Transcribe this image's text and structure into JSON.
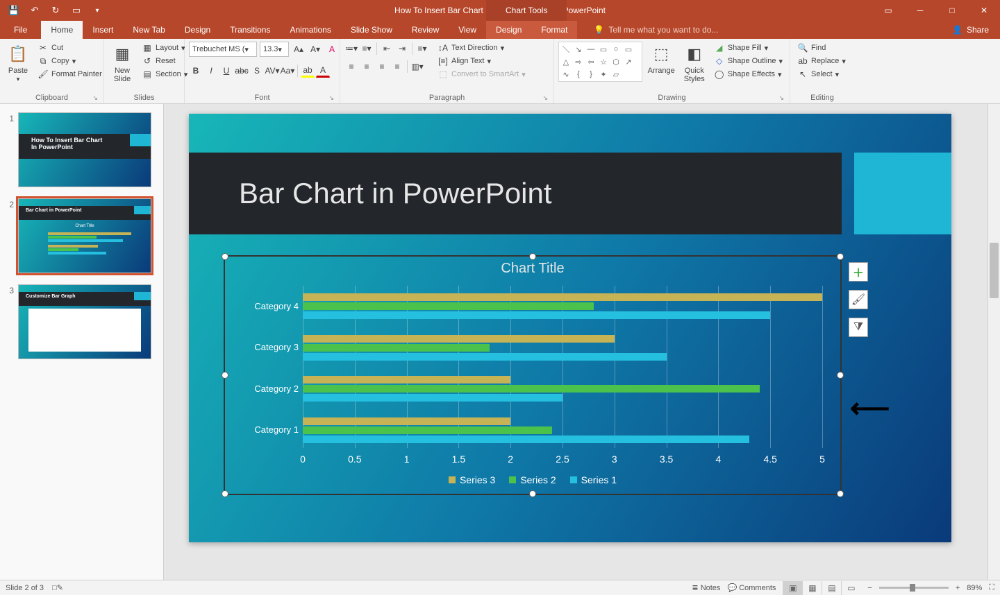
{
  "titlebar": {
    "doc_title": "How To Insert Bar Chart In PowerPoint.pptx - PowerPoint",
    "chart_tools": "Chart Tools"
  },
  "tabs": {
    "file": "File",
    "home": "Home",
    "insert": "Insert",
    "newtab": "New Tab",
    "design": "Design",
    "transitions": "Transitions",
    "animations": "Animations",
    "slideshow": "Slide Show",
    "review": "Review",
    "view": "View",
    "ctx_design": "Design",
    "ctx_format": "Format",
    "tellme": "Tell me what you want to do...",
    "share": "Share"
  },
  "ribbon": {
    "clipboard": {
      "label": "Clipboard",
      "paste": "Paste",
      "cut": "Cut",
      "copy": "Copy",
      "format_painter": "Format Painter"
    },
    "slides": {
      "label": "Slides",
      "new_slide": "New\nSlide",
      "layout": "Layout",
      "reset": "Reset",
      "section": "Section"
    },
    "font": {
      "label": "Font",
      "family": "Trebuchet MS (",
      "size": "13.3"
    },
    "paragraph": {
      "label": "Paragraph",
      "text_direction": "Text Direction",
      "align_text": "Align Text",
      "smartart": "Convert to SmartArt"
    },
    "drawing": {
      "label": "Drawing",
      "arrange": "Arrange",
      "quick_styles": "Quick\nStyles",
      "shape_fill": "Shape Fill",
      "shape_outline": "Shape Outline",
      "shape_effects": "Shape Effects"
    },
    "editing": {
      "label": "Editing",
      "find": "Find",
      "replace": "Replace",
      "select": "Select"
    }
  },
  "thumbs": {
    "t1": "How To Insert Bar Chart\nIn PowerPoint",
    "t2": "Bar Chart in PowerPoint",
    "t3": "Customize Bar Graph"
  },
  "slide": {
    "title": "Bar Chart in PowerPoint"
  },
  "chart_data": {
    "type": "bar",
    "title": "Chart Title",
    "orientation": "horizontal",
    "categories": [
      "Category 4",
      "Category 3",
      "Category 2",
      "Category 1"
    ],
    "series": [
      {
        "name": "Series 3",
        "color": "#c5b356",
        "values": [
          5.0,
          3.0,
          2.0,
          2.0
        ]
      },
      {
        "name": "Series 2",
        "color": "#4bc24b",
        "values": [
          2.8,
          1.8,
          4.4,
          2.4
        ]
      },
      {
        "name": "Series 1",
        "color": "#25bfe0",
        "values": [
          4.5,
          3.5,
          2.5,
          4.3
        ]
      }
    ],
    "xlim": [
      0,
      5
    ],
    "xticks": [
      0,
      0.5,
      1,
      1.5,
      2,
      2.5,
      3,
      3.5,
      4,
      4.5,
      5
    ]
  },
  "statusbar": {
    "slide_info": "Slide 2 of 3",
    "notes": "Notes",
    "comments": "Comments",
    "zoom": "89%"
  }
}
